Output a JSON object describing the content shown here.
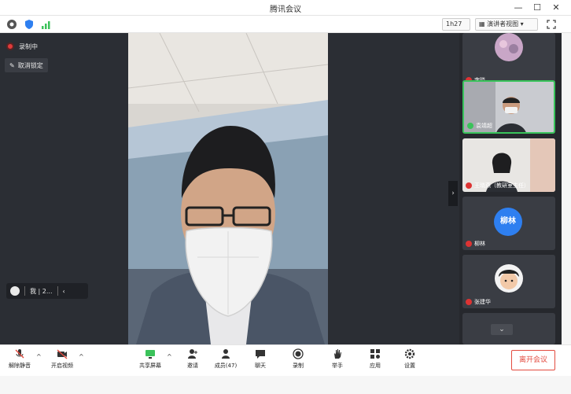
{
  "window": {
    "title": "腾讯会议",
    "minimize": "—",
    "maximize": "☐",
    "close": "✕"
  },
  "toolbar": {
    "duration": "1h27",
    "view_mode": "演讲者视图"
  },
  "stage": {
    "recording_label": "录制中",
    "pin_label": "取消锁定",
    "self_chip_name": "我 | 2..."
  },
  "participants": [
    {
      "name": "李晓",
      "mic": "muted"
    },
    {
      "name": "袁靖超",
      "mic": "on",
      "active": true
    },
    {
      "name": "王晓燕（教研室主任）",
      "mic": "muted"
    },
    {
      "name": "柳林",
      "mic": "muted",
      "avatar_text": "柳林"
    },
    {
      "name": "张建华",
      "mic": "muted"
    }
  ],
  "bottombar": {
    "mic_label": "解除静音",
    "camera_label": "开启视频",
    "share_label": "共享屏幕",
    "invite_label": "邀请",
    "members_label": "成员(47)",
    "chat_label": "聊天",
    "record_label": "录制",
    "raise_label": "举手",
    "apps_label": "应用",
    "settings_label": "设置",
    "leave_label": "离开会议"
  },
  "colors": {
    "accent_green": "#39c45b",
    "danger_red": "#e34b3f",
    "avatar_blue": "#2e7ff0"
  }
}
